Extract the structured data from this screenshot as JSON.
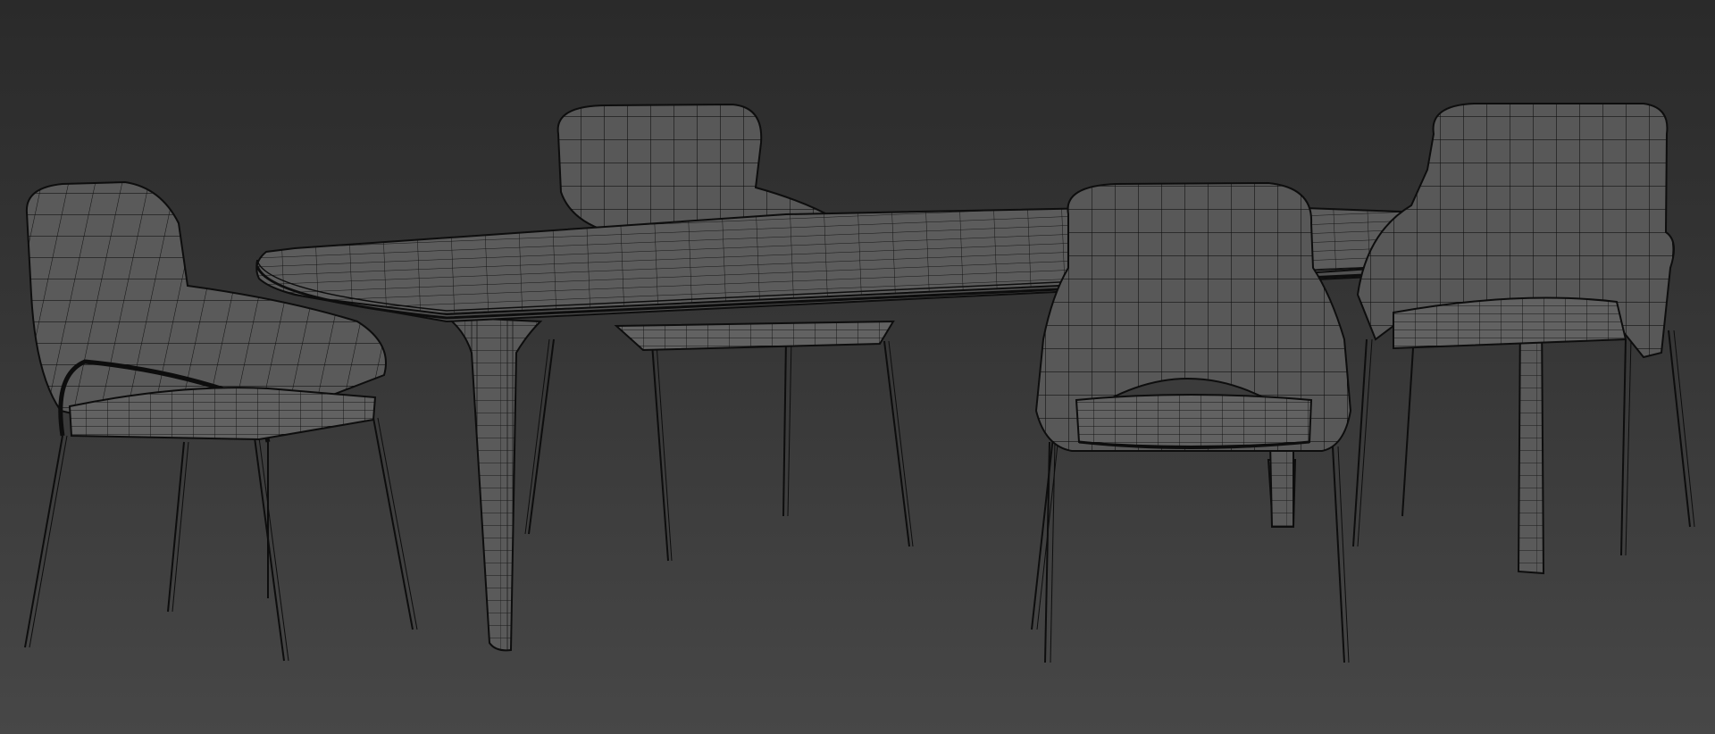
{
  "viewport": {
    "background_top": "#2a2a2a",
    "background_bottom": "#474747"
  },
  "model": {
    "surface_color": "#555555",
    "wire_color": "#0d0d0d",
    "objects": [
      "chair-left",
      "chair-back-center",
      "table",
      "chair-front",
      "chair-right"
    ]
  }
}
